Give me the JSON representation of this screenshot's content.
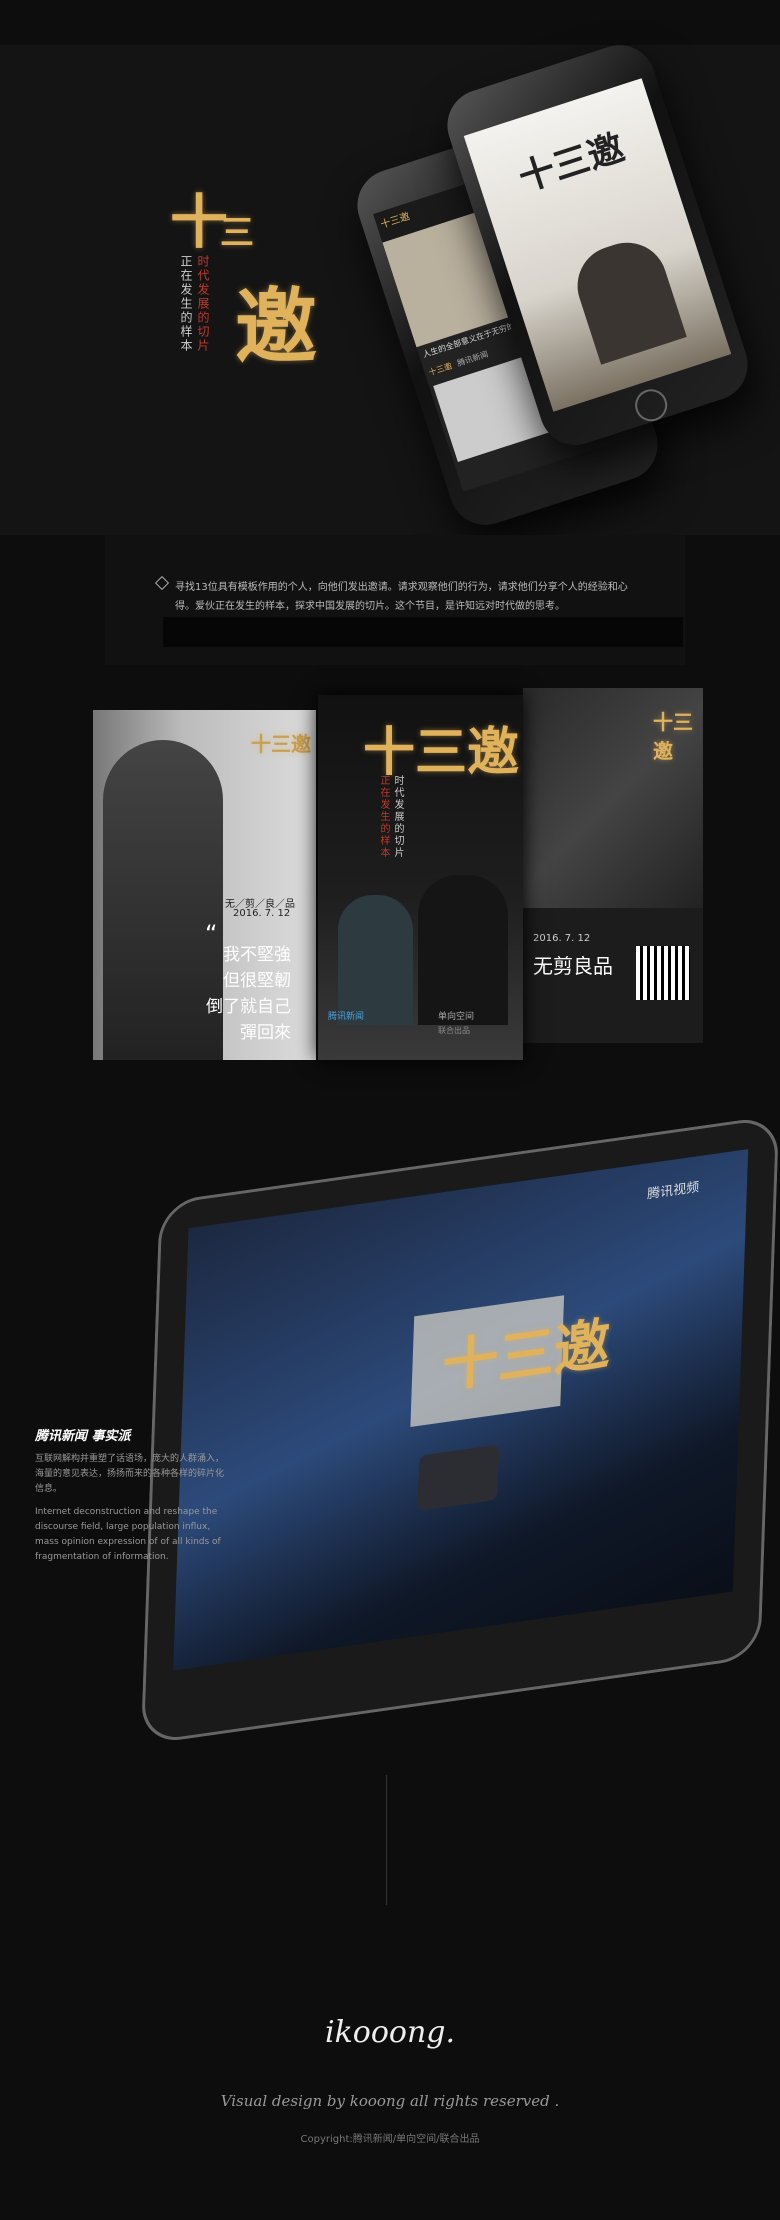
{
  "hero": {
    "logo_title": "十三邀",
    "logo_char_1": "十",
    "logo_char_2": "三",
    "logo_char_3": "邀",
    "tagline_col1": "时代发展的切片",
    "tagline_col2": "正在发生的样本"
  },
  "phone_front": {
    "title": "十三邀"
  },
  "phone_back": {
    "header": "十三邀",
    "subtitle": "人生的全部意义在于无穷的可能性",
    "tab_1": "十三邀",
    "tab_2": "腾讯新闻"
  },
  "description": {
    "text": "寻找13位具有模板作用的个人，向他们发出邀请。请求观察他们的行为，请求他们分享个人的经验和心得。爱伙正在发生的样本，探求中国发展的切片。这个节目，是许知远对时代做的思考。"
  },
  "poster_left": {
    "logo": "十三邀",
    "series": "无／剪／良／品",
    "date": "2016. 7. 12",
    "quote_mark": "“",
    "quote_1": "我不堅強",
    "quote_2": "但很堅韌",
    "quote_3": "倒了就自己",
    "quote_4": "彈回來"
  },
  "poster_center": {
    "logo": "十三邀",
    "tagline_col1": "时代发展的切片",
    "tagline_col2": "正在发生的样本",
    "brand_1": "腾讯新闻",
    "brand_2": "单向空间",
    "brand_3": "联合出品"
  },
  "poster_right": {
    "logo": "十三邀",
    "date": "2016. 7. 12",
    "title": "无剪良品"
  },
  "tablet": {
    "watermark": "腾讯视频",
    "logo": "十三邀"
  },
  "side_caption": {
    "brand": "腾讯新闻 事实派",
    "cn": "互联网解构并重塑了话语场，庞大的人群涌入，海量的意见表达，扬扬而来的各种各样的碎片化信息。",
    "en": "Internet deconstruction and reshape the discourse field, large population influx, mass opinion expression of of all kinds of fragmentation of information."
  },
  "footer": {
    "signature": "ikooong.",
    "credit": "Visual design by kooong all rights reserved .",
    "copyright": "Copyright:腾讯新闻/单向空间/联合出品"
  },
  "colors": {
    "gold": "#e0b25c",
    "red": "#c0392b",
    "bg": "#0d0d0d"
  }
}
